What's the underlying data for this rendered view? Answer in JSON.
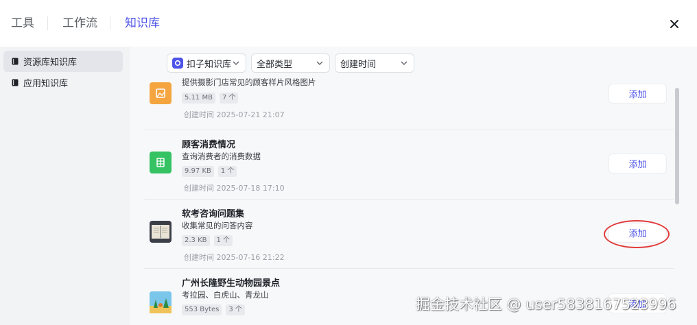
{
  "header": {
    "tabs": [
      {
        "label": "工具"
      },
      {
        "label": "工作流"
      },
      {
        "label": "知识库"
      }
    ]
  },
  "sidebar": {
    "items": [
      {
        "label": "资源库知识库",
        "active": true
      },
      {
        "label": "应用知识库",
        "active": false
      }
    ]
  },
  "filters": {
    "source": "扣子知识库",
    "type": "全部类型",
    "sort": "创建时间"
  },
  "list": {
    "items": [
      {
        "title": "",
        "desc": "提供摄影门店常见的顾客样片风格图片",
        "size": "5.11 MB",
        "count": "7 个",
        "time": "创建时间  2025-07-21 21:07",
        "icon": "image-kb-icon",
        "color": "#f5a540",
        "add_label": "添加"
      },
      {
        "title": "顾客消费情况",
        "desc": "查询消费者的消费数据",
        "size": "9.97 KB",
        "count": "1 个",
        "time": "创建时间  2025-07-18 17:10",
        "icon": "table-kb-icon",
        "color": "#34c263",
        "add_label": "添加"
      },
      {
        "title": "软考咨询问题集",
        "desc": "收集常见的问答内容",
        "size": "2.3 KB",
        "count": "1 个",
        "time": "创建时间  2025-07-16 21:22",
        "icon": "book-thumbnail-icon",
        "color": "#3a3f47",
        "add_label": "添加"
      },
      {
        "title": "广州长隆野生动物园景点",
        "desc": "考拉园、白虎山、青龙山",
        "size": "553 Bytes",
        "count": "3 个",
        "time": "",
        "icon": "zoo-thumbnail-icon",
        "color": "#2f8fc4",
        "add_label": "添加"
      }
    ]
  },
  "watermark": "掘金技术社区 @ user5838167523996",
  "colors": {
    "accent": "#4d53e8",
    "highlight": "#e23a3a",
    "sidebar_bg": "#f2f3f5",
    "main_bg": "#f7f8fa"
  }
}
